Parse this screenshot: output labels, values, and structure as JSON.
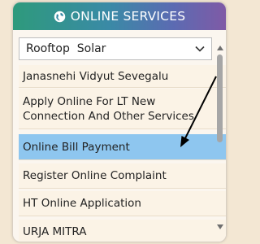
{
  "header": {
    "title": "ONLINE SERVICES",
    "icon": "globe-icon"
  },
  "select": {
    "value": "Rooftop  Solar",
    "icon": "chevron-down-icon"
  },
  "items": [
    {
      "label": "Janasnehi Vidyut Sevegalu"
    },
    {
      "label": "Apply Online For LT New Connection And Other Services"
    },
    {
      "label": "Online Bill Payment"
    },
    {
      "label": "Register Online Complaint"
    },
    {
      "label": "HT Online Application"
    },
    {
      "label": "URJA MITRA"
    }
  ],
  "colors": {
    "active_item": "#8ec6ef",
    "annotation_arrow": "#000000"
  }
}
